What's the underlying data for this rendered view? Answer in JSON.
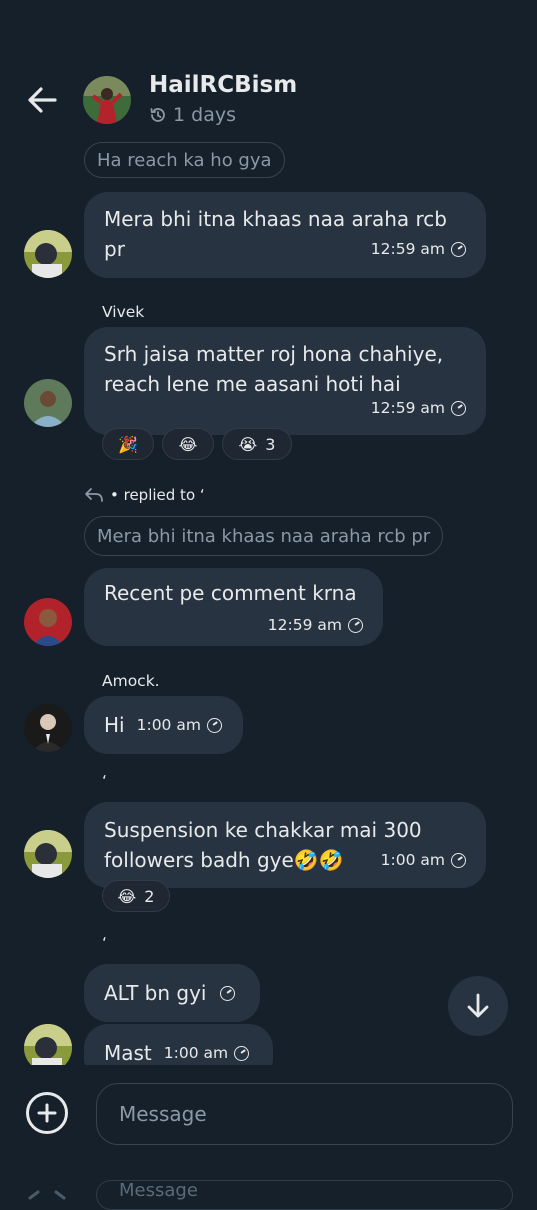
{
  "header": {
    "title": "HailRCBism",
    "disappearing_timer": "1 days"
  },
  "messages": {
    "quoted_top": "Ha reach ka ho gya",
    "m1": {
      "text_line1": "Mera bhi itna khaas naa araha rcb",
      "text_line2": "pr",
      "time": "12:59 am"
    },
    "m2": {
      "sender": "Vivek",
      "text_line1": "Srh jaisa matter roj hona chahiye,",
      "text_line2": "reach lene me aasani hoti hai",
      "time": "12:59 am",
      "reactions": [
        {
          "emoji": "🎉",
          "count": ""
        },
        {
          "emoji": "😂",
          "count": ""
        },
        {
          "emoji": "😭",
          "count": "3"
        }
      ]
    },
    "m3": {
      "replied_label": "• replied to ‘",
      "quoted": "Mera bhi itna khaas naa araha rcb pr",
      "text": "Recent pe comment krna",
      "time": "12:59 am"
    },
    "m4": {
      "sender": "Amock.",
      "text": "Hi",
      "time": "1:00 am"
    },
    "m5": {
      "sender": "‘",
      "text_line1": "Suspension ke chakkar mai 300",
      "text_line2": "followers badh gye🤣🤣",
      "time": "1:00 am",
      "reactions": [
        {
          "emoji": "😂",
          "count": "2"
        }
      ]
    },
    "m6": {
      "sender": "‘",
      "text": "ALT bn gyi",
      "time": ""
    },
    "m7": {
      "text": "Mast",
      "time": "1:00 am"
    }
  },
  "composer": {
    "placeholder": "Message",
    "ghost_placeholder": "Message"
  },
  "colors": {
    "background": "#15202b",
    "bubble": "#273340",
    "muted_text": "#8b98a5",
    "border": "#38444d"
  },
  "icons": [
    "back-arrow-icon",
    "timer-icon",
    "clock-icon",
    "reply-icon",
    "arrow-down-icon",
    "plus-icon"
  ]
}
